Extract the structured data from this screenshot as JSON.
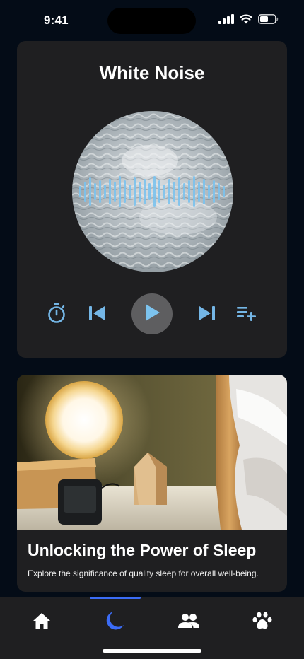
{
  "status_bar": {
    "time": "9:41"
  },
  "player": {
    "title": "White Noise",
    "icons": {
      "timer": "timer-icon",
      "previous": "skip-previous-icon",
      "play": "play-icon",
      "next": "skip-next-icon",
      "queue": "playlist-add-icon"
    }
  },
  "article": {
    "title": "Unlocking the Power of Sleep",
    "description": "Explore the significance of quality sleep for overall well-being."
  },
  "tabs": [
    {
      "icon": "home-icon",
      "active": false
    },
    {
      "icon": "moon-icon",
      "active": true
    },
    {
      "icon": "people-icon",
      "active": false
    },
    {
      "icon": "paw-icon",
      "active": false
    }
  ],
  "colors": {
    "accent": "#3b6cf6",
    "control_blue": "#74b6e6",
    "card_bg": "#1f1f21",
    "page_bg": "#040c17"
  }
}
